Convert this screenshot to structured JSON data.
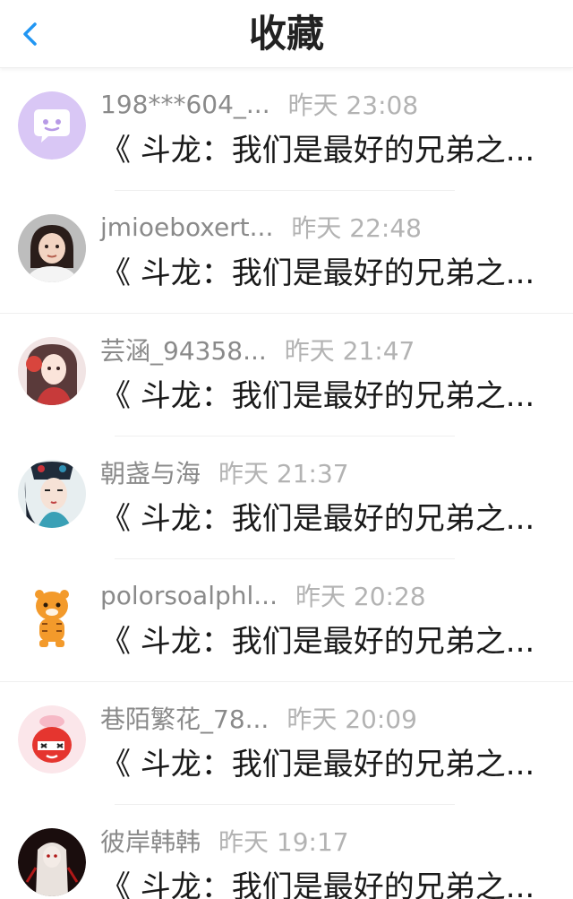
{
  "header": {
    "title": "收藏",
    "back_icon": "chevron-left-icon",
    "accent_color": "#2196F3"
  },
  "items": [
    {
      "user": "198***604_...",
      "time": "昨天 23:08",
      "message": "《 斗龙：我们是最好的兄弟之...",
      "avatar": "chat-bubble-avatar"
    },
    {
      "user": "jmioeboxert...",
      "time": "昨天 22:48",
      "message": "《 斗龙：我们是最好的兄弟之...",
      "avatar": "girl-photo-avatar"
    },
    {
      "user": "芸涵_94358...",
      "time": "昨天 21:47",
      "message": "《 斗龙：我们是最好的兄弟之...",
      "avatar": "anime-girl-avatar"
    },
    {
      "user": "朝盏与海",
      "time": "昨天 21:37",
      "message": "《 斗龙：我们是最好的兄弟之...",
      "avatar": "illustrated-woman-avatar"
    },
    {
      "user": "polorsoalphl...",
      "time": "昨天 20:28",
      "message": "《 斗龙：我们是最好的兄弟之...",
      "avatar": "tiger-cartoon-avatar"
    },
    {
      "user": "巷陌繁花_78...",
      "time": "昨天 20:09",
      "message": "《 斗龙：我们是最好的兄弟之...",
      "avatar": "red-cartoon-avatar"
    },
    {
      "user": "彼岸韩韩",
      "time": "昨天 19:17",
      "message": "《 斗龙：我们是最好的兄弟之...",
      "avatar": "dark-figure-avatar"
    }
  ]
}
